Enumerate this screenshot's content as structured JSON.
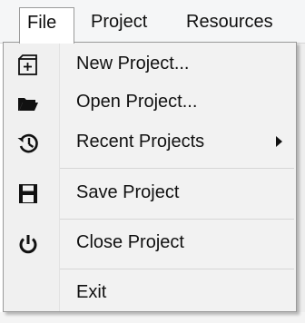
{
  "menubar": {
    "file": "File",
    "project": "Project",
    "resources": "Resources"
  },
  "menu": {
    "items": [
      {
        "label": "New Project...",
        "icon": "new-project-icon"
      },
      {
        "label": "Open Project...",
        "icon": "folder-open-icon"
      },
      {
        "label": "Recent Projects",
        "icon": "history-icon",
        "submenu": true
      },
      {
        "label": "Save Project",
        "icon": "floppy-disk-icon"
      },
      {
        "label": "Close Project",
        "icon": "power-icon"
      },
      {
        "label": "Exit",
        "icon": ""
      }
    ]
  }
}
